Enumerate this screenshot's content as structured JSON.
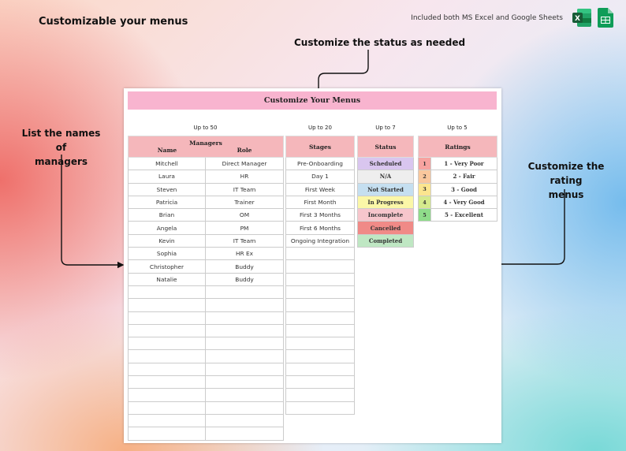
{
  "header": {
    "title": "Customizable your menus",
    "compat_text": "Included both MS Excel and Google Sheets",
    "excel_icon": "excel-icon",
    "sheets_icon": "google-sheets-icon"
  },
  "callouts": {
    "status": "Customize the status as needed",
    "managers": "List the names of managers",
    "managers_line1": "List the names of",
    "managers_line2": "managers",
    "rating": "Customize the rating menus",
    "rating_line1": "Customize the rating",
    "rating_line2": "menus"
  },
  "sheet": {
    "title": "Customize Your Menus",
    "limits": {
      "managers": "Up to 50",
      "stages": "Up to 20",
      "status": "Up to 7",
      "ratings": "Up to 5"
    },
    "managers": {
      "header": "Managers",
      "col_name": "Name",
      "col_role": "Role",
      "rows": [
        [
          "Mitchell",
          "Direct Manager"
        ],
        [
          "Laura",
          "HR"
        ],
        [
          "Steven",
          "IT Team"
        ],
        [
          "Patricia",
          "Trainer"
        ],
        [
          "Brian",
          "OM"
        ],
        [
          "Angela",
          "PM"
        ],
        [
          "Kevin",
          "IT Team"
        ],
        [
          "Sophia",
          "HR Ex"
        ],
        [
          "Christopher",
          "Buddy"
        ],
        [
          "Natalie",
          "Buddy"
        ]
      ],
      "total_rows": 22
    },
    "stages": {
      "header": "Stages",
      "rows": [
        "Pre-Onboarding",
        "Day 1",
        "First Week",
        "First Month",
        "First 3 Months",
        "First 6 Months",
        "Ongoing Integration"
      ],
      "total_rows": 20
    },
    "status": {
      "header": "Status",
      "rows": [
        {
          "label": "Scheduled",
          "color": "#d9c6ef"
        },
        {
          "label": "N/A",
          "color": "#eeeeee"
        },
        {
          "label": "Not Started",
          "color": "#c5dff0"
        },
        {
          "label": "In Progress",
          "color": "#fbf7a8"
        },
        {
          "label": "Incomplete",
          "color": "#f7c6cc"
        },
        {
          "label": "Cancelled",
          "color": "#f08a87"
        },
        {
          "label": "Completed",
          "color": "#bfe7c3"
        }
      ]
    },
    "ratings": {
      "header": "Ratings",
      "rows": [
        {
          "num": "1",
          "label": "1 - Very Poor",
          "color": "#f7a3a0"
        },
        {
          "num": "2",
          "label": "2 - Fair",
          "color": "#f9c79d"
        },
        {
          "num": "3",
          "label": "3 - Good",
          "color": "#fbe58f"
        },
        {
          "num": "4",
          "label": "4 - Very Good",
          "color": "#d5ea8d"
        },
        {
          "num": "5",
          "label": "5 - Excellent",
          "color": "#8fdc8a"
        }
      ]
    }
  }
}
